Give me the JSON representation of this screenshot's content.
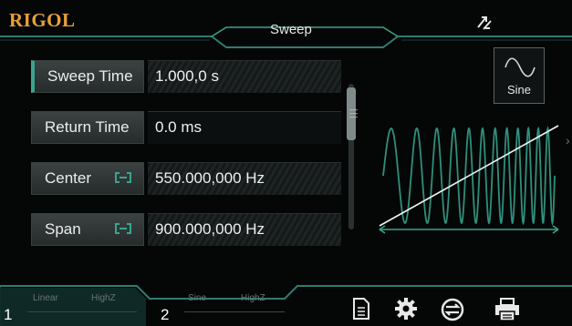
{
  "header": {
    "logo": "RIGOL",
    "title": "Sweep",
    "sync_icon": "sync-arrows-icon"
  },
  "params": [
    {
      "label": "Sweep Time",
      "value": "1.000,0 s",
      "active": true,
      "linked": false
    },
    {
      "label": "Return Time",
      "value": "0.0 ms",
      "active": false,
      "linked": false
    },
    {
      "label": "Center",
      "value": "550.000,000 Hz",
      "active": false,
      "linked": true
    },
    {
      "label": "Span",
      "value": "900.000,000 Hz",
      "active": false,
      "linked": true
    }
  ],
  "waveform_button": {
    "label": "Sine",
    "icon": "sine-wave-icon"
  },
  "channels": [
    {
      "number": "1",
      "wave": "Linear",
      "load": "HighZ",
      "active": true
    },
    {
      "number": "2",
      "wave": "Sine",
      "load": "HighZ",
      "active": false
    }
  ],
  "toolbar": [
    "document-icon",
    "gear-icon",
    "sync-circle-icon",
    "printer-icon"
  ],
  "colors": {
    "accent": "#3aa48e",
    "logo": "#e8a13a",
    "background": "#050707"
  }
}
